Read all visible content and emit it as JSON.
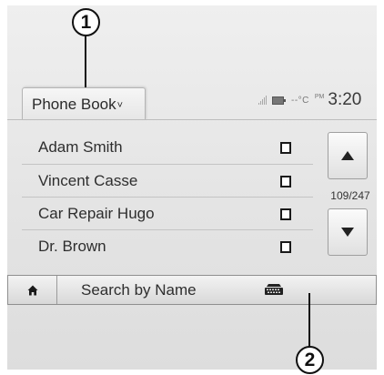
{
  "callouts": [
    "1",
    "2"
  ],
  "header": {
    "title": "Phone Book",
    "title_chevron": "˅"
  },
  "status": {
    "temperature": "--°C",
    "ampm": "PM",
    "time": "3:20",
    "icons": [
      "signal-icon",
      "battery-icon"
    ]
  },
  "contacts": [
    {
      "name": "Adam Smith",
      "icon": "phone-icon"
    },
    {
      "name": "Vincent Casse",
      "icon": "phone-icon"
    },
    {
      "name": "Car Repair Hugo",
      "icon": "phone-icon"
    },
    {
      "name": "Dr. Brown",
      "icon": "phone-icon"
    }
  ],
  "pagination": {
    "counter": "109/247"
  },
  "bottom_bar": {
    "home_icon": "home-icon",
    "search_label": "Search by Name",
    "keyboard_icon": "keyboard-icon"
  }
}
